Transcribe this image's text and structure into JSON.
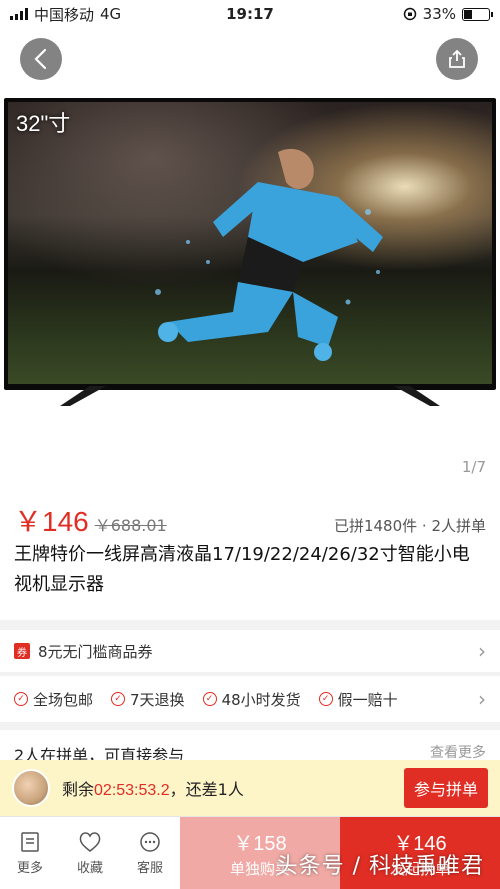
{
  "status_bar": {
    "carrier": "中国移动",
    "network": "4G",
    "time": "19:17",
    "battery": "33%",
    "battery_level": 0.33
  },
  "hero": {
    "size_label": "32\"寸",
    "page_indicator": "1/7"
  },
  "product": {
    "price_current": "￥146",
    "price_original": "￥688.01",
    "group_info": "已拼1480件 · 2人拼单",
    "title": "王牌特价一线屏高清液晶17/19/22/24/26/32寸智能小电视机显示器"
  },
  "coupon": {
    "tag": "券",
    "label": "8元无门槛商品券"
  },
  "services": [
    "全场包邮",
    "7天退换",
    "48小时发货",
    "假一赔十"
  ],
  "group_section": {
    "title": "2人在拼单，可直接参与",
    "more": "查看更多"
  },
  "countdown": {
    "prefix": "剩余",
    "time": "02:53:53.2",
    "suffix": "，还差1人",
    "join_label": "参与拼单"
  },
  "bottom_bar": {
    "more": "更多",
    "favorite": "收藏",
    "service": "客服",
    "solo_price": "￥158",
    "solo_label": "单独购买",
    "group_price": "￥146",
    "group_label": "发起拼单"
  },
  "watermark": "头条号 / 科技禹唯君",
  "colors": {
    "accent": "#e02e24",
    "accent_light": "#f0a9a4",
    "banner_bg": "#fdf4c8"
  }
}
